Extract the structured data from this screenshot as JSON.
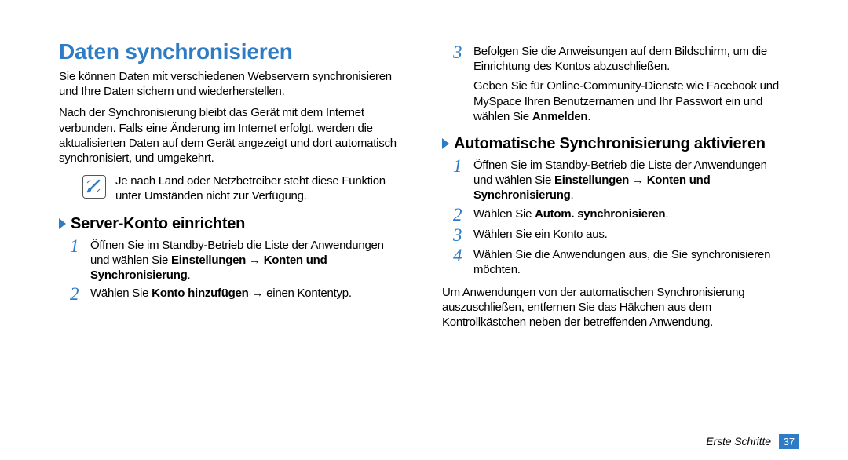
{
  "title": "Daten synchronisieren",
  "intro1": "Sie können Daten mit verschiedenen Webservern synchronisieren und Ihre Daten sichern und wiederherstellen.",
  "intro2": "Nach der Synchronisierung bleibt das Gerät mit dem Internet verbunden. Falls eine Änderung im Internet erfolgt, werden die aktualisierten Daten auf dem Gerät angezeigt und dort automatisch synchronisiert, und umgekehrt.",
  "note": "Je nach Land oder Netzbetreiber steht diese Funktion unter Umständen nicht zur Verfügung.",
  "section1": {
    "heading": "Server-Konto einrichten",
    "steps": {
      "1": {
        "a": "Öffnen Sie im Standby-Betrieb die Liste der Anwendungen und wählen Sie ",
        "b": "Einstellungen",
        "c": " → ",
        "d": "Konten und Synchronisierung",
        "e": "."
      },
      "2": {
        "a": "Wählen Sie ",
        "b": "Konto hinzufügen",
        "c": " → einen Kontentyp."
      }
    }
  },
  "right_steps": {
    "3": {
      "a": "Befolgen Sie die Anweisungen auf dem Bildschirm, um die Einrichtung des Kontos abzuschließen.",
      "b": "Geben Sie für Online-Community-Dienste wie Facebook und MySpace Ihren Benutzernamen und Ihr Passwort ein und wählen Sie ",
      "c": "Anmelden",
      "d": "."
    }
  },
  "section2": {
    "heading": "Automatische Synchronisierung aktivieren",
    "steps": {
      "1": {
        "a": "Öffnen Sie im Standby-Betrieb die Liste der Anwendungen und wählen Sie ",
        "b": "Einstellungen",
        "c": " → ",
        "d": "Konten und Synchronisierung",
        "e": "."
      },
      "2": {
        "a": "Wählen Sie ",
        "b": "Autom. synchronisieren",
        "c": "."
      },
      "3": "Wählen Sie ein Konto aus.",
      "4": "Wählen Sie die Anwendungen aus, die Sie synchronisieren möchten."
    }
  },
  "outro": "Um Anwendungen von der automatischen Synchronisierung auszuschließen, entfernen Sie das Häkchen aus dem Kontrollkästchen neben der betreffenden Anwendung.",
  "footer": {
    "section": "Erste Schritte",
    "page": "37"
  }
}
